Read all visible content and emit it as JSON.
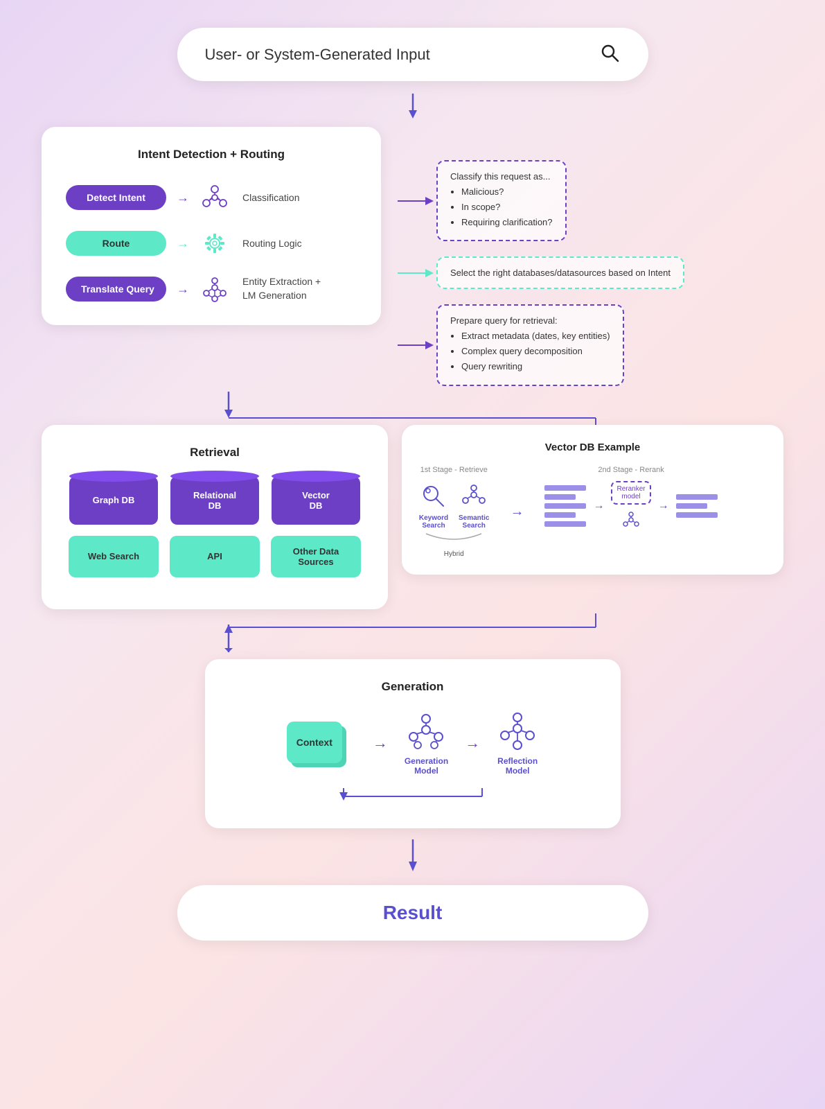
{
  "search": {
    "placeholder": "User- or System-Generated Input",
    "icon": "search-icon"
  },
  "intent_section": {
    "title": "Intent Detection + Routing",
    "rows": [
      {
        "btn_label": "Detect Intent",
        "btn_style": "purple",
        "icon_type": "network",
        "label": "Classification",
        "callout_style": "purple",
        "callout_text": "Classify this request as...",
        "callout_bullets": [
          "Malicious?",
          "In scope?",
          "Requiring clarification?"
        ]
      },
      {
        "btn_label": "Route",
        "btn_style": "teal",
        "icon_type": "gear",
        "label": "Routing Logic",
        "callout_style": "teal",
        "callout_text": "Select the right databases/datasources based on Intent",
        "callout_bullets": []
      },
      {
        "btn_label": "Translate Query",
        "btn_style": "purple",
        "icon_type": "network",
        "label": "Entity Extraction +\nLM Generation",
        "callout_style": "purple",
        "callout_text": "Prepare query for retrieval:",
        "callout_bullets": [
          "Extract metadata (dates, key entities)",
          "Complex query decomposition",
          "Query rewriting"
        ]
      }
    ]
  },
  "retrieval_section": {
    "title": "Retrieval",
    "databases": [
      {
        "label": "Graph DB",
        "style": "cylinder"
      },
      {
        "label": "Relational\nDB",
        "style": "cylinder"
      },
      {
        "label": "Vector\nDB",
        "style": "cylinder"
      }
    ],
    "others": [
      {
        "label": "Web Search",
        "style": "teal"
      },
      {
        "label": "API",
        "style": "teal"
      },
      {
        "label": "Other Data\nSources",
        "style": "teal"
      }
    ]
  },
  "vector_db": {
    "title": "Vector DB Example",
    "stage1_label": "1st Stage - Retrieve",
    "stage2_label": "2nd Stage - Rerank",
    "items": [
      {
        "label": "Keyword\nSearch"
      },
      {
        "label": "Semantic\nSearch"
      }
    ],
    "hybrid_label": "Hybrid",
    "reranker_label": "Reranker\nmodel"
  },
  "generation_section": {
    "title": "Generation",
    "context_label": "Context",
    "model1_label": "Generation\nModel",
    "model2_label": "Reflection\nModel"
  },
  "result": {
    "label": "Result"
  }
}
